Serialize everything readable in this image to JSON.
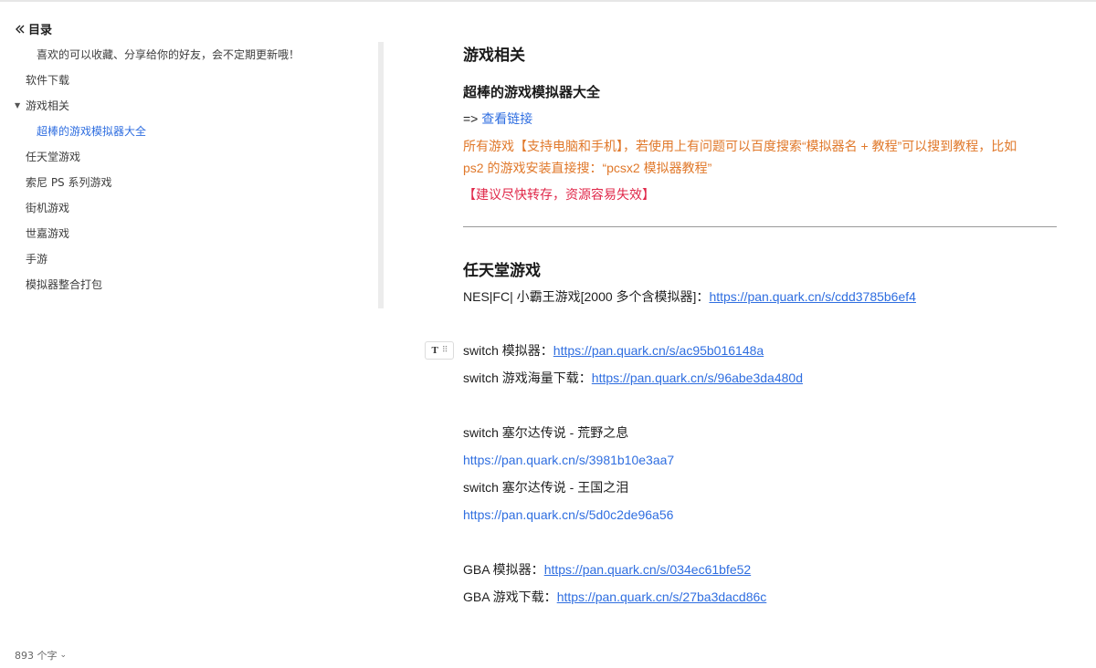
{
  "sidebar": {
    "toc_title": "目录",
    "items": [
      {
        "label": "喜欢的可以收藏、分享给你的好友，会不定期更新哦！",
        "level": 2,
        "active": false
      },
      {
        "label": "软件下载",
        "level": 1,
        "active": false
      },
      {
        "label": "游戏相关",
        "level": 1,
        "active": false,
        "expanded": true
      },
      {
        "label": "超棒的游戏模拟器大全",
        "level": 2,
        "active": true
      },
      {
        "label": "任天堂游戏",
        "level": 1,
        "active": false
      },
      {
        "label": "索尼 PS 系列游戏",
        "level": 1,
        "active": false
      },
      {
        "label": "街机游戏",
        "level": 1,
        "active": false
      },
      {
        "label": "世嘉游戏",
        "level": 1,
        "active": false
      },
      {
        "label": "手游",
        "level": 1,
        "active": false
      },
      {
        "label": "模拟器整合打包",
        "level": 1,
        "active": false
      }
    ],
    "word_count": "893 个字"
  },
  "content": {
    "section_games_title": "游戏相关",
    "emulator_title": "超棒的游戏模拟器大全",
    "view_prefix": "=> ",
    "view_link": "查看链接",
    "note_line1": "所有游戏【支持电脑和手机】，若使用上有问题可以百度搜索“模拟器名 + 教程”可以搜到教程，比如",
    "note_line2": "ps2 的游戏安装直接搜：“pcsx2 模拟器教程”",
    "warning": "【建议尽快转存，资源容易失效】",
    "nintendo_title": "任天堂游戏",
    "nes_label": "NES|FC| 小霸王游戏[2000 多个含模拟器]：",
    "nes_link": "https://pan.quark.cn/s/cdd3785b6ef4",
    "switch_emu_label": "switch 模拟器：",
    "switch_emu_link": "https://pan.quark.cn/s/ac95b016148a",
    "switch_games_label": "switch 游戏海量下载：",
    "switch_games_link": "https://pan.quark.cn/s/96abe3da480d",
    "zelda_botw_label": "switch 塞尔达传说 - 荒野之息",
    "zelda_botw_link": "https://pan.quark.cn/s/3981b10e3aa7",
    "zelda_totk_label": "switch 塞尔达传说 - 王国之泪",
    "zelda_totk_link": "https://pan.quark.cn/s/5d0c2de96a56",
    "gba_emu_label": "GBA 模拟器：",
    "gba_emu_link": "https://pan.quark.cn/s/034ec61bfe52",
    "gba_games_label": "GBA 游戏下载：",
    "gba_games_link": "https://pan.quark.cn/s/27ba3dacd86c"
  },
  "colors": {
    "accent": "#2f6ee0",
    "orange_text": "#e0782a",
    "red_text": "#e0284a"
  }
}
